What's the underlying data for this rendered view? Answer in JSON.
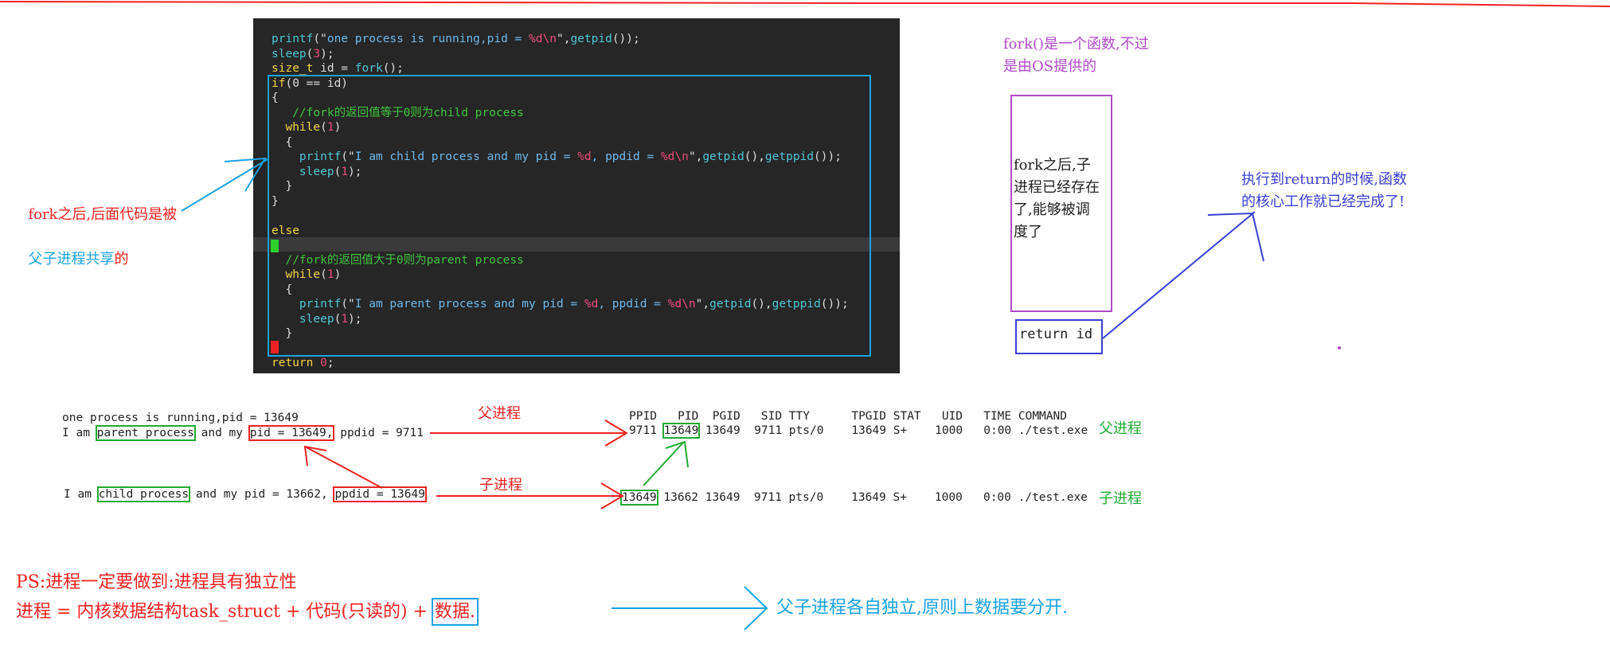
{
  "code": {
    "lines": [
      "printf(\"one process is running,pid = %d\\n\",getpid());",
      "sleep(3);",
      "size_t id = fork();",
      "if(0 == id)",
      "{",
      "   //fork的返回值等于0则为child process",
      "  while(1)",
      "  {",
      "    printf(\"I am child process and my pid = %d, ppdid = %d\\n\",getpid(),getppid());",
      "    sleep(1);",
      "  }",
      "}",
      "",
      "else",
      "{",
      "  //fork的返回值大于0则为parent process",
      "  while(1)",
      "  {",
      "    printf(\"I am parent process and my pid = %d, ppdid = %d\\n\",getpid(),getppid());",
      "    sleep(1);",
      "  }",
      "}",
      "return 0;"
    ]
  },
  "output": {
    "line1": "one process is running,pid = 13649",
    "line2_prefix": "I am ",
    "line2_box1": "parent process",
    "line2_mid": " and my ",
    "line2_box2": "pid = 13649,",
    "line2_tail": " ppdid = 9711",
    "line3_prefix": "I am ",
    "line3_box1": "child process",
    "line3_mid": " and my pid = 13662, ",
    "line3_box2": "ppdid = 13649"
  },
  "ps": {
    "header": "PPID   PID  PGID   SID TTY      TPGID STAT   UID   TIME COMMAND",
    "row1_ppid": "9711",
    "row1_pid": "13649",
    "row1_rest": "13649  9711 pts/0    13649 S+    1000   0:00 ./test.exe",
    "row2_ppid": "13649",
    "row2_pid": "13662",
    "row2_rest": "13649  9711 pts/0    13649 S+    1000   0:00 ./test.exe",
    "label_parent": "父进程",
    "label_child": "子进程"
  },
  "annotations": {
    "fork_shared_red": "fork之后,后面代码是被",
    "fork_shared_blue": "父子进程共享",
    "fork_shared_tail": "的",
    "fork_func": "fork()是一个函数,不过\n是由OS提供的",
    "fork_after": "fork之后,子\n进程已经存在\n了,能够被调\n度了",
    "return_id": "return id",
    "return_note": "执行到return的时候,函数\n的核心工作就已经完成了!",
    "arrow_parent": "父进程",
    "arrow_child": "子进程",
    "ps_note1": "PS:进程一定要做到:进程具有独立性",
    "ps_note2_prefix": "进程 = 内核数据结构task_struct + 代码(只读的) + ",
    "ps_note2_box": "数据.",
    "ps_note3": "父子进程各自独立,原则上数据要分开."
  },
  "colors": {
    "red": "#ee2222",
    "blue": "#1aa3e0",
    "purple": "#b04ac8",
    "indigo": "#3a3fd1",
    "green": "#22aa33"
  }
}
